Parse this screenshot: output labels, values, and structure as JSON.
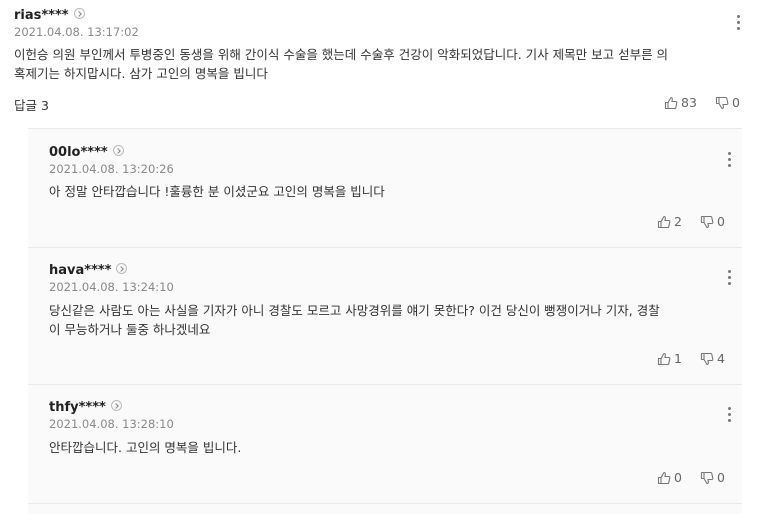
{
  "comment": {
    "user": "rias****",
    "time": "2021.04.08. 13:17:02",
    "text_line1": "이헌승 의원 부인께서 투병중인 동생을 위해 간이식 수술을 했는데 수술후 건강이 악화되었답니다. 기사 제목만 보고 섣부른 의",
    "text_line2": "혹제기는 하지맙시다. 삼가 고인의 명복을 빕니다",
    "reply_label": "답글",
    "reply_count": "3",
    "likes": "83",
    "dislikes": "0"
  },
  "replies": [
    {
      "user": "00lo****",
      "time": "2021.04.08. 13:20:26",
      "line1": "아 정말 안타깝습니다 !훌륭한 분 이셨군요 고인의 명복을 빕니다",
      "line2": "",
      "likes": "2",
      "dislikes": "0"
    },
    {
      "user": "hava****",
      "time": "2021.04.08. 13:24:10",
      "line1": "당신같은 사람도 아는 사실을 기자가 아니 경찰도 모르고 사망경위를 얘기 못한다? 이건 당신이 뻥쟁이거나 기자, 경찰",
      "line2": "이 무능하거나 둘중 하나겠네요",
      "likes": "1",
      "dislikes": "4"
    },
    {
      "user": "thfy****",
      "time": "2021.04.08. 13:28:10",
      "line1": "안타깝습니다. 고인의 명복을 빕니다.",
      "line2": "",
      "likes": "0",
      "dislikes": "0"
    }
  ],
  "icons": {
    "profile": "chevron-right-icon",
    "more": "more-vertical-icon",
    "like": "thumbs-up-icon",
    "dislike": "thumbs-down-icon"
  }
}
